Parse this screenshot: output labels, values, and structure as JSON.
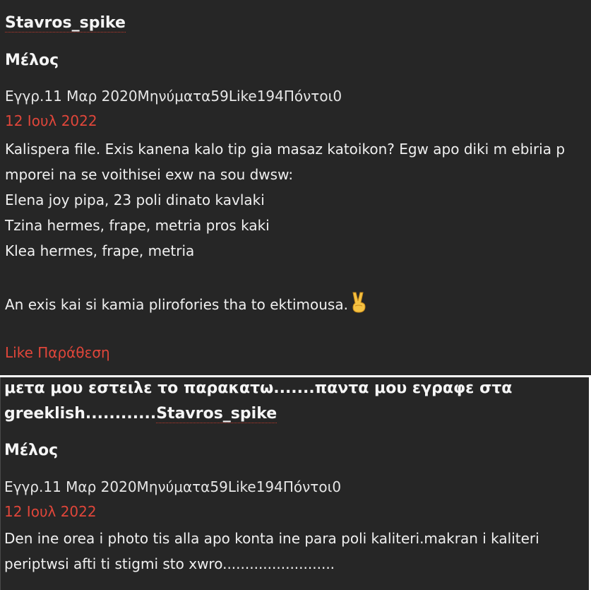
{
  "post1": {
    "username": "Stavros_spike",
    "role": "Μέλος",
    "meta": "Εγγρ.11 Μαρ 2020Μηνύματα59Like194Πόντοι0",
    "date": "12 Ιουλ 2022",
    "lines": [
      "Kalispera file. Exis kanena kalo tip gia masaz katoikon? Egw apo diki m ebiria p",
      "mporei na se voithisei exw na sou dwsw:",
      "Elena joy pipa, 23 poli dinato kavlaki",
      "Tzina hermes, frape, metria pros kaki",
      "Klea hermes, frape, metria"
    ],
    "closing": "An exis kai si kamia plirofories tha to ektimousa.",
    "emoji_icon": "victory-hand-icon",
    "like_label": "Like",
    "quote_label": "Παράθεση"
  },
  "post2": {
    "headline_line1": "μετα μου εστειλε το παρακατω.......παντα μου εγραφε στα",
    "headline_line2": "greeklish............",
    "username": "Stavros_spike",
    "role": "Μέλος",
    "meta": "Εγγρ.11 Μαρ 2020Μηνύματα59Like194Πόντοι0",
    "date": "12 Ιουλ 2022",
    "lines": [
      "Den ine orea i photo tis alla apo konta ine para poli kaliteri.makran i kaliteri",
      "periptwsi afti ti stigmi sto xwro........................."
    ]
  },
  "colors": {
    "background": "#262626",
    "accent_red": "#e0463a",
    "text": "#f0f0f0"
  }
}
